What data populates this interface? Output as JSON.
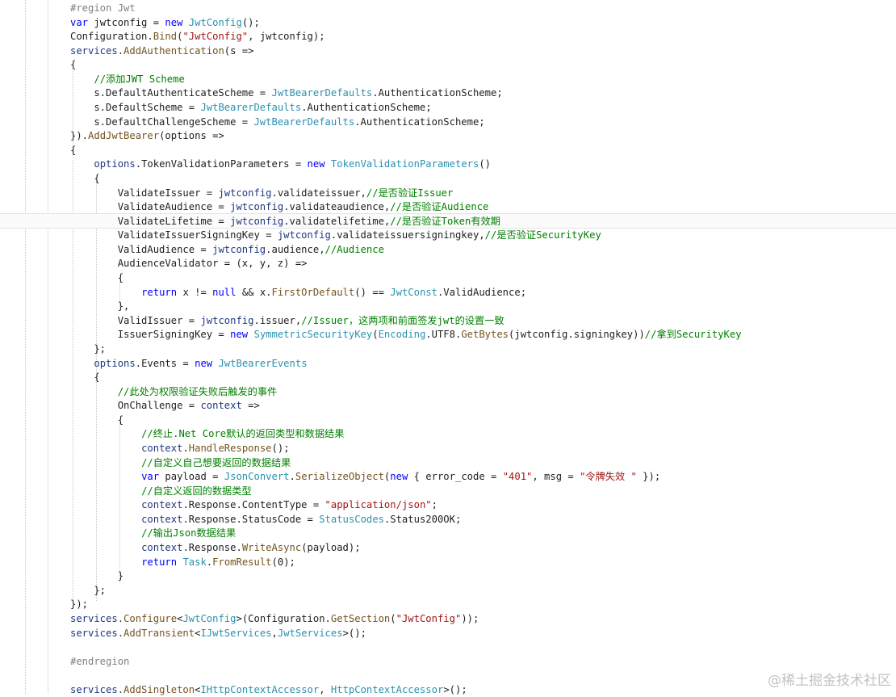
{
  "editor": {
    "lines": [
      [
        [
          "#region Jwt",
          "prep"
        ]
      ],
      [
        [
          "var ",
          "kw"
        ],
        [
          "jwtconfig",
          " pl"
        ],
        [
          " = ",
          "pl"
        ],
        [
          "new ",
          "kw"
        ],
        [
          "JwtConfig",
          "type"
        ],
        [
          "();",
          "pl"
        ]
      ],
      [
        [
          "Configuration.",
          "pl"
        ],
        [
          "Bind",
          "mth"
        ],
        [
          "(",
          "pl"
        ],
        [
          "\"JwtConfig\"",
          "str"
        ],
        [
          ", jwtconfig);",
          "pl"
        ]
      ],
      [
        [
          "services.",
          "fld"
        ],
        [
          "AddAuthentication",
          "mth"
        ],
        [
          "(s =>",
          "pl"
        ]
      ],
      [
        [
          "{",
          "pl"
        ]
      ],
      [
        [
          "    ",
          "pl"
        ],
        [
          "//添加JWT Scheme",
          "cm"
        ]
      ],
      [
        [
          "    s.DefaultAuthenticateScheme = ",
          "pl"
        ],
        [
          "JwtBearerDefaults",
          "type"
        ],
        [
          ".AuthenticationScheme;",
          "pl"
        ]
      ],
      [
        [
          "    s.DefaultScheme = ",
          "pl"
        ],
        [
          "JwtBearerDefaults",
          "type"
        ],
        [
          ".AuthenticationScheme;",
          "pl"
        ]
      ],
      [
        [
          "    s.DefaultChallengeScheme = ",
          "pl"
        ],
        [
          "JwtBearerDefaults",
          "type"
        ],
        [
          ".AuthenticationScheme;",
          "pl"
        ]
      ],
      [
        [
          "}).",
          "pl"
        ],
        [
          "AddJwtBearer",
          "mth"
        ],
        [
          "(options =>",
          "pl"
        ]
      ],
      [
        [
          "{",
          "pl"
        ]
      ],
      [
        [
          "    ",
          "pl"
        ],
        [
          "options",
          "fld"
        ],
        [
          ".TokenValidationParameters = ",
          "pl"
        ],
        [
          "new ",
          "kw"
        ],
        [
          "TokenValidationParameters",
          "type"
        ],
        [
          "()",
          "pl"
        ]
      ],
      [
        [
          "    {",
          "pl"
        ]
      ],
      [
        [
          "        ValidateIssuer = ",
          "pl"
        ],
        [
          "jwtconfig",
          "fld"
        ],
        [
          ".validateissuer,",
          "pl"
        ],
        [
          "//是否验证Issuer",
          "cm"
        ]
      ],
      [
        [
          "        ValidateAudience = ",
          "pl"
        ],
        [
          "jwtconfig",
          "fld"
        ],
        [
          ".validateaudience,",
          "pl"
        ],
        [
          "//是否验证Audience",
          "cm"
        ]
      ],
      [
        [
          "        ValidateLifetime = ",
          "pl"
        ],
        [
          "jwtconfig",
          "fld"
        ],
        [
          ".validatelifetime,",
          "pl"
        ],
        [
          "//是否验证Token有效期",
          "cm"
        ]
      ],
      [
        [
          "        ValidateIssuerSigningKey = ",
          "pl"
        ],
        [
          "jwtconfig",
          "fld"
        ],
        [
          ".validateissuersigningkey,",
          "pl"
        ],
        [
          "//是否验证SecurityKey",
          "cm"
        ]
      ],
      [
        [
          "        ValidAudience = ",
          "pl"
        ],
        [
          "jwtconfig",
          "fld"
        ],
        [
          ".audience,",
          "pl"
        ],
        [
          "//Audience",
          "cm"
        ]
      ],
      [
        [
          "        AudienceValidator = (x, y, z) =>",
          "pl"
        ]
      ],
      [
        [
          "        {",
          "pl"
        ]
      ],
      [
        [
          "            ",
          "pl"
        ],
        [
          "return ",
          "kw"
        ],
        [
          "x != ",
          "pl"
        ],
        [
          "null ",
          "kw"
        ],
        [
          "&& x.",
          "pl"
        ],
        [
          "FirstOrDefault",
          "mth"
        ],
        [
          "() == ",
          "pl"
        ],
        [
          "JwtConst",
          "type"
        ],
        [
          ".ValidAudience;",
          "pl"
        ]
      ],
      [
        [
          "        },",
          "pl"
        ]
      ],
      [
        [
          "        ValidIssuer = ",
          "pl"
        ],
        [
          "jwtconfig",
          "fld"
        ],
        [
          ".issuer,",
          "pl"
        ],
        [
          "//Issuer，这两项和前面签发jwt的设置一致",
          "cm"
        ]
      ],
      [
        [
          "        IssuerSigningKey = ",
          "pl"
        ],
        [
          "new ",
          "kw"
        ],
        [
          "SymmetricSecurityKey",
          "type"
        ],
        [
          "(",
          "pl"
        ],
        [
          "Encoding",
          "type"
        ],
        [
          ".UTF8.",
          "pl"
        ],
        [
          "GetBytes",
          "mth"
        ],
        [
          "(jwtconfig.signingkey))",
          "pl"
        ],
        [
          "//拿到SecurityKey",
          "cm"
        ]
      ],
      [
        [
          "    };",
          "pl"
        ]
      ],
      [
        [
          "    ",
          "pl"
        ],
        [
          "options",
          "fld"
        ],
        [
          ".Events = ",
          "pl"
        ],
        [
          "new ",
          "kw"
        ],
        [
          "JwtBearerEvents",
          "type"
        ]
      ],
      [
        [
          "    {",
          "pl"
        ]
      ],
      [
        [
          "        ",
          "pl"
        ],
        [
          "//此处为权限验证失败后触发的事件",
          "cm"
        ]
      ],
      [
        [
          "        OnChallenge = ",
          "pl"
        ],
        [
          "context ",
          "fld"
        ],
        [
          "=>",
          "pl"
        ]
      ],
      [
        [
          "        {",
          "pl"
        ]
      ],
      [
        [
          "            ",
          "pl"
        ],
        [
          "//终止.Net Core默认的返回类型和数据结果",
          "cm"
        ]
      ],
      [
        [
          "            ",
          "pl"
        ],
        [
          "context",
          "fld"
        ],
        [
          ".",
          "pl"
        ],
        [
          "HandleResponse",
          "mth"
        ],
        [
          "();",
          "pl"
        ]
      ],
      [
        [
          "            ",
          "pl"
        ],
        [
          "//自定义自己想要返回的数据结果",
          "cm"
        ]
      ],
      [
        [
          "            ",
          "pl"
        ],
        [
          "var ",
          "kw"
        ],
        [
          "payload = ",
          "pl"
        ],
        [
          "JsonConvert",
          "type"
        ],
        [
          ".",
          "pl"
        ],
        [
          "SerializeObject",
          "mth"
        ],
        [
          "(",
          "pl"
        ],
        [
          "new ",
          "kw"
        ],
        [
          "{ error_code = ",
          "pl"
        ],
        [
          "\"401\"",
          "str"
        ],
        [
          ", msg = ",
          "pl"
        ],
        [
          "\"令牌失效 \"",
          "str"
        ],
        [
          " });",
          "pl"
        ]
      ],
      [
        [
          "            ",
          "pl"
        ],
        [
          "//自定义返回的数据类型",
          "cm"
        ]
      ],
      [
        [
          "            ",
          "pl"
        ],
        [
          "context",
          "fld"
        ],
        [
          ".Response.ContentType = ",
          "pl"
        ],
        [
          "\"application/json\"",
          "str"
        ],
        [
          ";",
          "pl"
        ]
      ],
      [
        [
          "            ",
          "pl"
        ],
        [
          "context",
          "fld"
        ],
        [
          ".Response.StatusCode = ",
          "pl"
        ],
        [
          "StatusCodes",
          "type"
        ],
        [
          ".Status200OK;",
          "pl"
        ]
      ],
      [
        [
          "            ",
          "pl"
        ],
        [
          "//输出Json数据结果",
          "cm"
        ]
      ],
      [
        [
          "            ",
          "pl"
        ],
        [
          "context",
          "fld"
        ],
        [
          ".Response.",
          "pl"
        ],
        [
          "WriteAsync",
          "mth"
        ],
        [
          "(payload);",
          "pl"
        ]
      ],
      [
        [
          "            ",
          "pl"
        ],
        [
          "return ",
          "kw"
        ],
        [
          "Task",
          "type"
        ],
        [
          ".",
          "pl"
        ],
        [
          "FromResult",
          "mth"
        ],
        [
          "(0);",
          "pl"
        ]
      ],
      [
        [
          "        }",
          "pl"
        ]
      ],
      [
        [
          "    };",
          "pl"
        ]
      ],
      [
        [
          "});",
          "pl"
        ]
      ],
      [
        [
          "services.",
          "fld"
        ],
        [
          "Configure",
          "mth"
        ],
        [
          "<",
          "pl"
        ],
        [
          "JwtConfig",
          "type"
        ],
        [
          ">(Configuration.",
          "pl"
        ],
        [
          "GetSection",
          "mth"
        ],
        [
          "(",
          "pl"
        ],
        [
          "\"JwtConfig\"",
          "str"
        ],
        [
          "));",
          "pl"
        ]
      ],
      [
        [
          "services.",
          "fld"
        ],
        [
          "AddTransient",
          "mth"
        ],
        [
          "<",
          "pl"
        ],
        [
          "IJwtServices",
          "type"
        ],
        [
          ",",
          "pl"
        ],
        [
          "JwtServices",
          "type"
        ],
        [
          ">();",
          "pl"
        ]
      ],
      [
        [
          "",
          "pl"
        ]
      ],
      [
        [
          "#endregion",
          "prep"
        ]
      ],
      [
        [
          "",
          "pl"
        ]
      ],
      [
        [
          "services.",
          "fld"
        ],
        [
          "AddSingleton",
          "mth"
        ],
        [
          "<",
          "pl"
        ],
        [
          "IHttpContextAccessor",
          "type"
        ],
        [
          ", ",
          "pl"
        ],
        [
          "HttpContextAccessor",
          "type"
        ],
        [
          ">();",
          "pl"
        ]
      ]
    ]
  },
  "watermark": "@稀土掘金技术社区"
}
